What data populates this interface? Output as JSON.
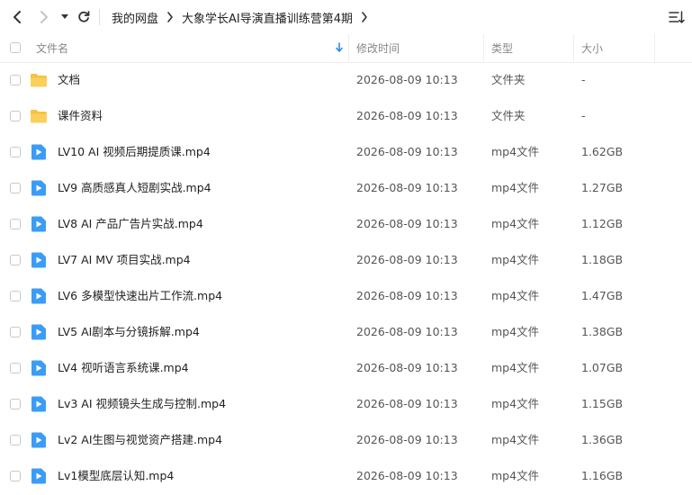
{
  "breadcrumb": {
    "root": "我的网盘",
    "current": "大象学长AI导演直播训练营第4期"
  },
  "columns": {
    "name": "文件名",
    "modified": "修改时间",
    "type": "类型",
    "size": "大小"
  },
  "colors": {
    "folder": "#f7c142",
    "video": "#3c9cf4",
    "link": "#333333"
  },
  "files": [
    {
      "name": "文档",
      "modified": "2026-08-09 10:13",
      "type": "文件夹",
      "size": "-",
      "kind": "folder"
    },
    {
      "name": "课件资料",
      "modified": "2026-08-09 10:13",
      "type": "文件夹",
      "size": "-",
      "kind": "folder"
    },
    {
      "name": "LV10 AI 视频后期提质课.mp4",
      "modified": "2026-08-09 10:13",
      "type": "mp4文件",
      "size": "1.62GB",
      "kind": "video"
    },
    {
      "name": "LV9 高质感真人短剧实战.mp4",
      "modified": "2026-08-09 10:13",
      "type": "mp4文件",
      "size": "1.27GB",
      "kind": "video"
    },
    {
      "name": "LV8 AI 产品广告片实战.mp4",
      "modified": "2026-08-09 10:13",
      "type": "mp4文件",
      "size": "1.12GB",
      "kind": "video"
    },
    {
      "name": "LV7 AI MV 项目实战.mp4",
      "modified": "2026-08-09 10:13",
      "type": "mp4文件",
      "size": "1.18GB",
      "kind": "video"
    },
    {
      "name": "LV6 多模型快速出片工作流.mp4",
      "modified": "2026-08-09 10:13",
      "type": "mp4文件",
      "size": "1.47GB",
      "kind": "video"
    },
    {
      "name": "LV5 AI剧本与分镜拆解.mp4",
      "modified": "2026-08-09 10:13",
      "type": "mp4文件",
      "size": "1.38GB",
      "kind": "video"
    },
    {
      "name": "LV4 视听语言系统课.mp4",
      "modified": "2026-08-09 10:13",
      "type": "mp4文件",
      "size": "1.07GB",
      "kind": "video"
    },
    {
      "name": "Lv3 AI 视频镜头生成与控制.mp4",
      "modified": "2026-08-09 10:13",
      "type": "mp4文件",
      "size": "1.15GB",
      "kind": "video"
    },
    {
      "name": "Lv2 AI生图与视觉资产搭建.mp4",
      "modified": "2026-08-09 10:13",
      "type": "mp4文件",
      "size": "1.36GB",
      "kind": "video"
    },
    {
      "name": "Lv1模型底层认知.mp4",
      "modified": "2026-08-09 10:13",
      "type": "mp4文件",
      "size": "1.16GB",
      "kind": "video"
    }
  ]
}
